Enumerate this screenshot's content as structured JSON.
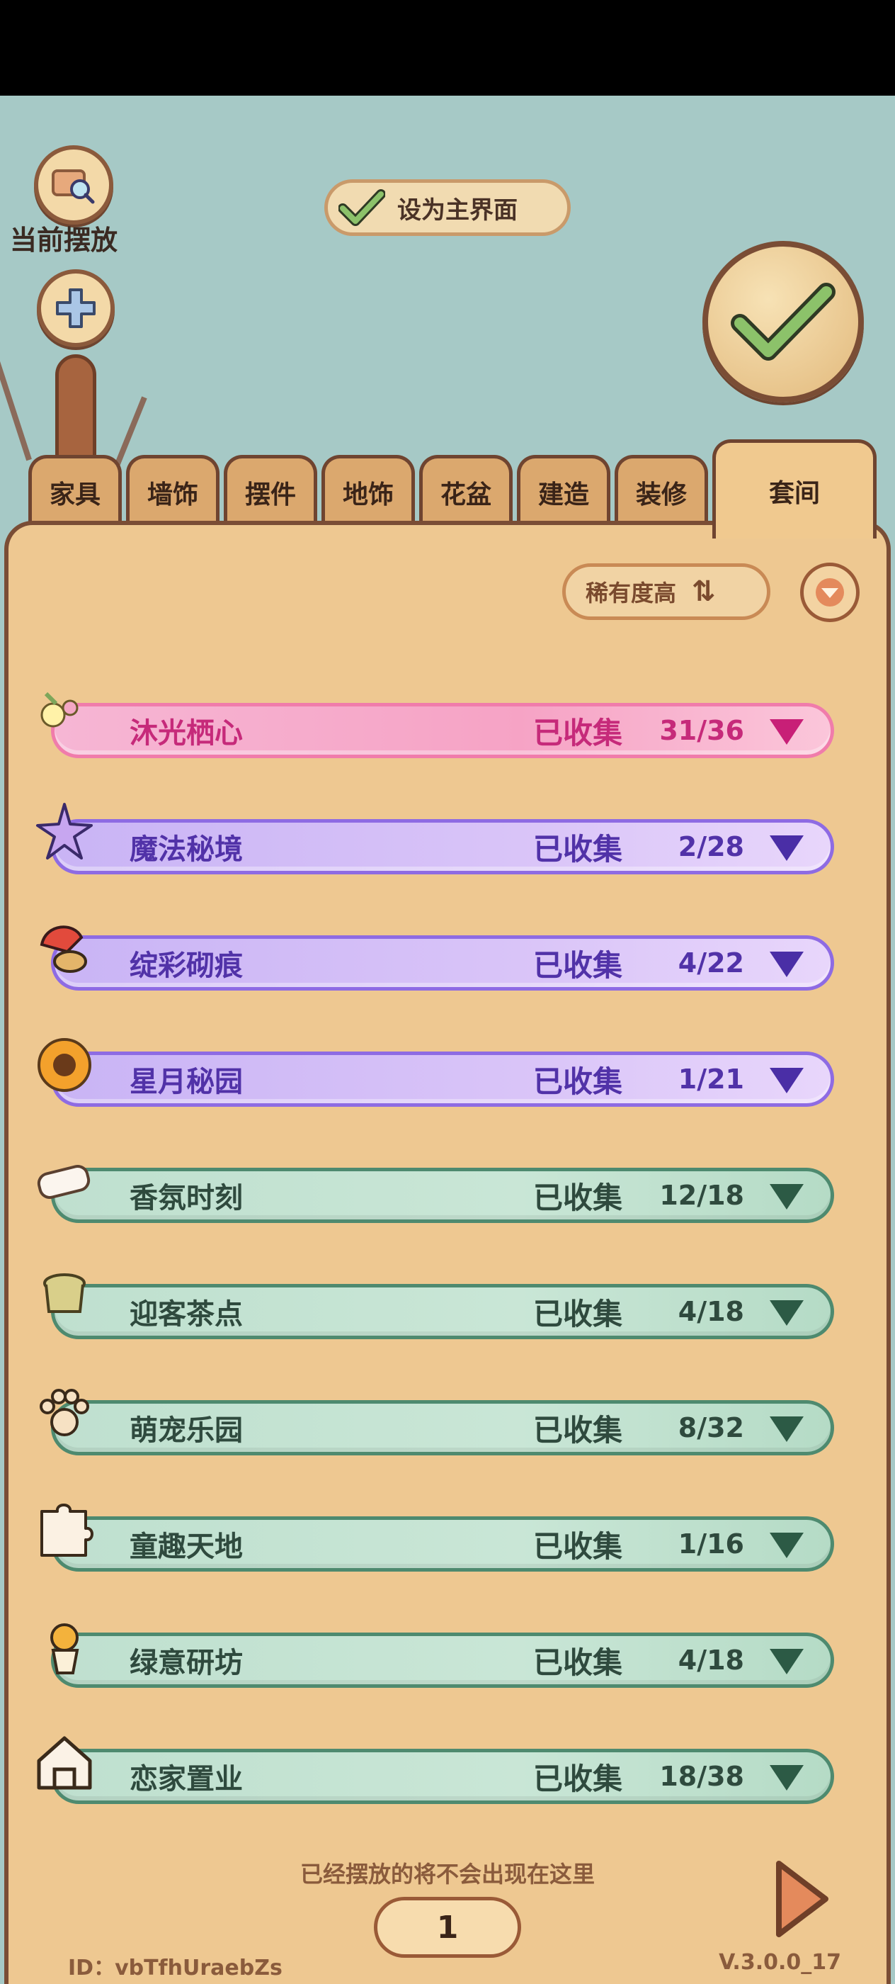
{
  "header": {
    "current_placement_label": "当前摆放",
    "set_main_label": "设为主界面"
  },
  "tabs": [
    {
      "label": "家具"
    },
    {
      "label": "墙饰"
    },
    {
      "label": "摆件"
    },
    {
      "label": "地饰"
    },
    {
      "label": "花盆"
    },
    {
      "label": "建造"
    },
    {
      "label": "装修"
    },
    {
      "label": "套间"
    }
  ],
  "sort": {
    "label": "稀有度高"
  },
  "rows": [
    {
      "title": "沐光栖心",
      "status": "已收集",
      "count": "31/36",
      "style": "pink",
      "icon": "flower-cluster-icon"
    },
    {
      "title": "魔法秘境",
      "status": "已收集",
      "count": "2/28",
      "style": "purple",
      "icon": "star-icon"
    },
    {
      "title": "绽彩砌痕",
      "status": "已收集",
      "count": "4/22",
      "style": "purple",
      "icon": "paint-icon"
    },
    {
      "title": "星月秘园",
      "status": "已收集",
      "count": "1/21",
      "style": "purple",
      "icon": "sunflower-icon"
    },
    {
      "title": "香氛时刻",
      "status": "已收集",
      "count": "12/18",
      "style": "green",
      "icon": "soap-icon"
    },
    {
      "title": "迎客茶点",
      "status": "已收集",
      "count": "4/18",
      "style": "green",
      "icon": "tea-icon"
    },
    {
      "title": "萌宠乐园",
      "status": "已收集",
      "count": "8/32",
      "style": "green",
      "icon": "paw-icon"
    },
    {
      "title": "童趣天地",
      "status": "已收集",
      "count": "1/16",
      "style": "green",
      "icon": "puzzle-icon"
    },
    {
      "title": "绿意研坊",
      "status": "已收集",
      "count": "4/18",
      "style": "green",
      "icon": "plant-icon"
    },
    {
      "title": "恋家置业",
      "status": "已收集",
      "count": "18/38",
      "style": "green",
      "icon": "house-icon"
    }
  ],
  "footer": {
    "note": "已经摆放的将不会出现在这里",
    "page": "1",
    "id": "ID：vbTfhUraebZs",
    "version": "V.3.0.0_17"
  }
}
